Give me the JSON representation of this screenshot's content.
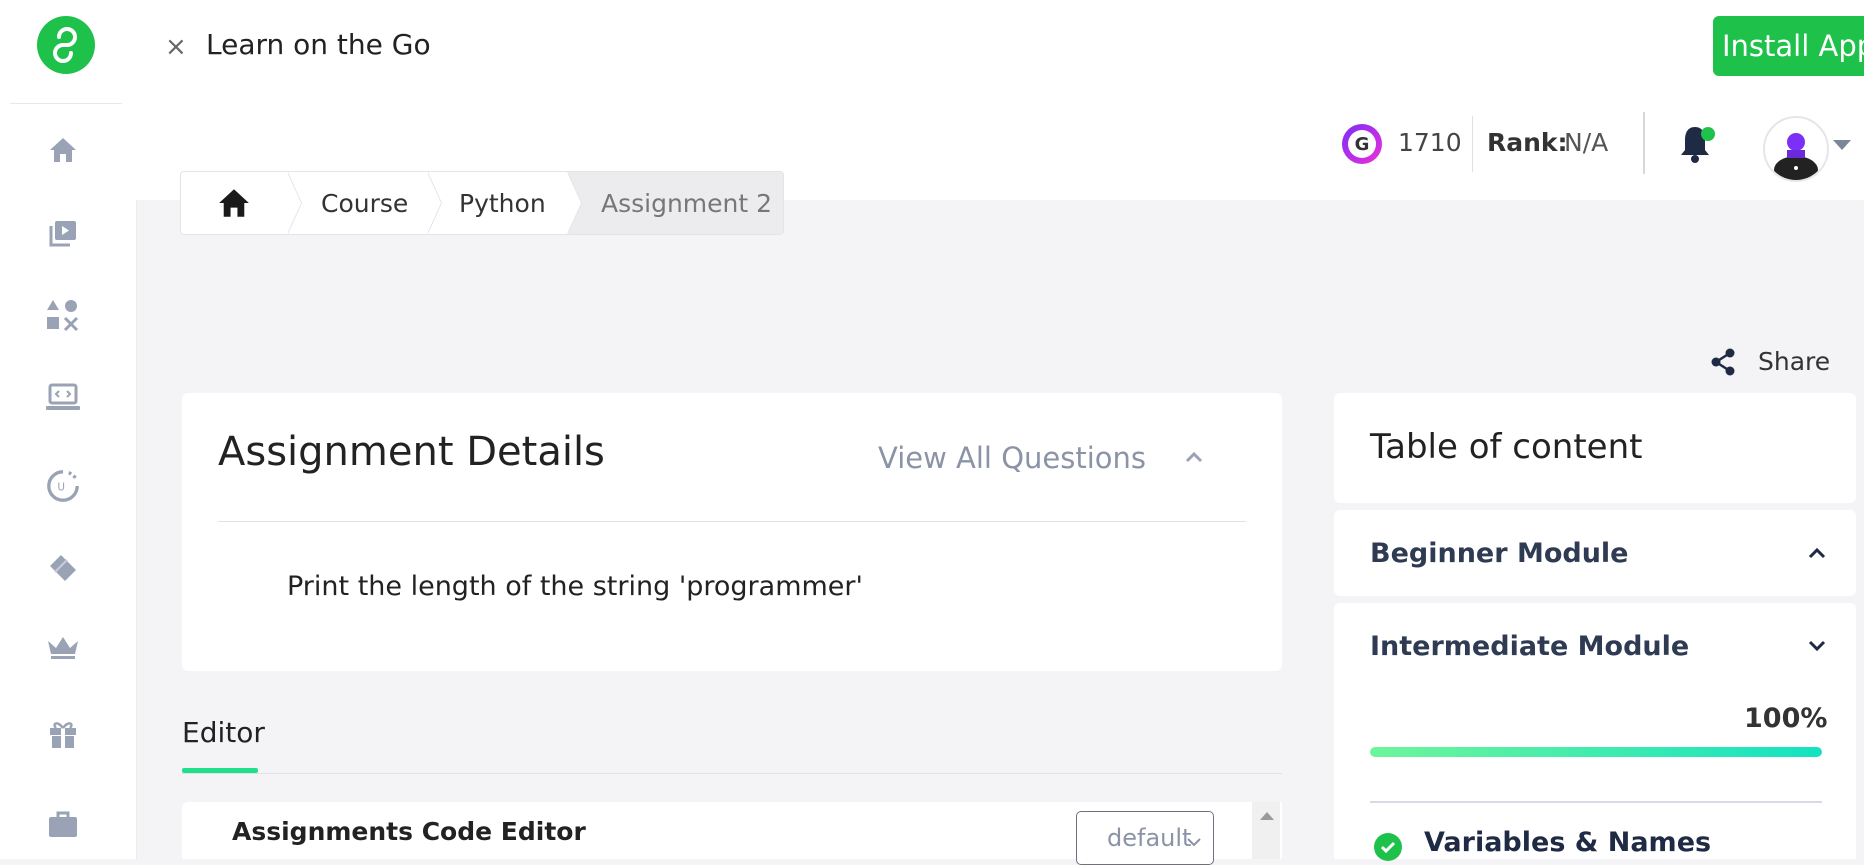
{
  "promo": {
    "title": "Learn on the Go",
    "close_symbol": "×",
    "install_label": "Install App",
    "accent_color": "#1ec24a"
  },
  "header": {
    "gems_count": "1710",
    "rank_label": "Rank:",
    "rank_value": "N/A"
  },
  "sidebar": {
    "items": [
      {
        "name": "home-icon"
      },
      {
        "name": "video-library-icon"
      },
      {
        "name": "categories-icon"
      },
      {
        "name": "code-laptop-icon"
      },
      {
        "name": "progress-icon"
      },
      {
        "name": "tag-icon"
      },
      {
        "name": "crown-icon"
      },
      {
        "name": "gift-icon"
      },
      {
        "name": "briefcase-icon"
      }
    ]
  },
  "breadcrumb": {
    "items": [
      "Course",
      "Python",
      "Assignment 2"
    ]
  },
  "share_label": "Share",
  "assignment": {
    "title": "Assignment Details",
    "view_all_label": "View All Questions",
    "question": "Print the length of the string 'programmer'"
  },
  "editor": {
    "tab_label": "Editor",
    "panel_title": "Assignments Code Editor",
    "theme_select_value": "default"
  },
  "toc": {
    "title": "Table of content",
    "modules": [
      {
        "title": "Beginner Module",
        "expanded": true
      },
      {
        "title": "Intermediate Module",
        "expanded": false,
        "progress_label": "100%",
        "progress": 1.0
      }
    ],
    "lessons": [
      {
        "title": "Variables & Names",
        "completed": true
      }
    ]
  }
}
